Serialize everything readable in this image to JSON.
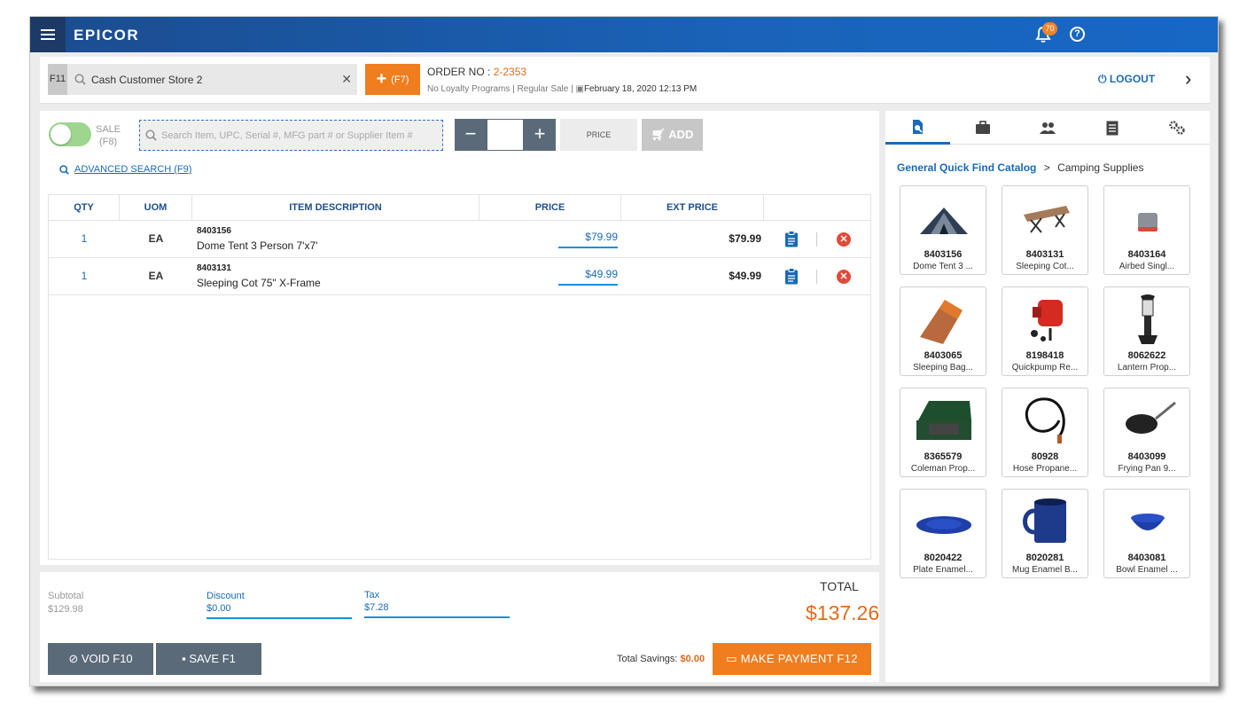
{
  "header": {
    "logo": "EPICOR",
    "notification_count": "70",
    "help_glyph": "?"
  },
  "customer_bar": {
    "f11_key": "F11",
    "customer_value": "Cash Customer Store 2",
    "add_customer_label": "(F7)",
    "order_no_label": "ORDER NO :",
    "order_no_value": "2-2353",
    "loyalty": "No Loyalty Programs",
    "sale_type": "Regular Sale",
    "date": "February 18, 2020 12:13 PM",
    "logout_label": "LOGOUT"
  },
  "toolbar": {
    "sale_label": "SALE",
    "sale_key": "(F8)",
    "search_placeholder": "Search Item, UPC, Serial #, MFG part # or Supplier Item #",
    "qty_value": "",
    "price_label": "PRICE",
    "add_label": "ADD",
    "advanced_search_label": "ADVANCED SEARCH (F9)"
  },
  "table": {
    "headers": {
      "qty": "QTY",
      "uom": "UOM",
      "desc": "ITEM DESCRIPTION",
      "price": "PRICE",
      "ext_price": "EXT PRICE"
    },
    "rows": [
      {
        "qty": "1",
        "uom": "EA",
        "code": "8403156",
        "desc": "Dome Tent 3 Person 7'x7'",
        "price": "$79.99",
        "ext_price": "$79.99"
      },
      {
        "qty": "1",
        "uom": "EA",
        "code": "8403131",
        "desc": "Sleeping Cot 75\" X-Frame",
        "price": "$49.99",
        "ext_price": "$49.99"
      }
    ]
  },
  "totals": {
    "subtotal_label": "Subtotal",
    "subtotal_value": "$129.98",
    "discount_label": "Discount",
    "discount_value": "$0.00",
    "tax_label": "Tax",
    "tax_value": "$7.28",
    "total_label": "TOTAL",
    "total_value": "$137.26",
    "savings_label": "Total Savings:",
    "savings_value": "$0.00",
    "void_label": "VOID F10",
    "save_label": "SAVE F1",
    "payment_label": "MAKE PAYMENT F12"
  },
  "catalog": {
    "tabs": [
      "quick-find-icon",
      "briefcase-icon",
      "customers-icon",
      "list-icon",
      "settings-icon"
    ],
    "breadcrumb_link": "General Quick Find Catalog",
    "breadcrumb_sep": ">",
    "breadcrumb_current": "Camping Supplies",
    "items": [
      {
        "code": "8403156",
        "name": "Dome Tent 3 ...",
        "icon": "tent-icon"
      },
      {
        "code": "8403131",
        "name": "Sleeping Cot...",
        "icon": "cot-icon"
      },
      {
        "code": "8403164",
        "name": "Airbed Singl...",
        "icon": "airbed-icon"
      },
      {
        "code": "8403065",
        "name": "Sleeping Bag...",
        "icon": "sleeping-bag-icon"
      },
      {
        "code": "8198418",
        "name": "Quickpump Re...",
        "icon": "pump-icon"
      },
      {
        "code": "8062622",
        "name": "Lantern Prop...",
        "icon": "lantern-icon"
      },
      {
        "code": "8365579",
        "name": "Coleman Prop...",
        "icon": "stove-icon"
      },
      {
        "code": "80928",
        "name": "Hose Propane...",
        "icon": "hose-icon"
      },
      {
        "code": "8403099",
        "name": "Frying Pan 9...",
        "icon": "pan-icon"
      },
      {
        "code": "8020422",
        "name": "Plate Enamel...",
        "icon": "plate-icon"
      },
      {
        "code": "8020281",
        "name": "Mug Enamel B...",
        "icon": "mug-icon"
      },
      {
        "code": "8403081",
        "name": "Bowl Enamel ...",
        "icon": "bowl-icon"
      }
    ]
  },
  "colors": {
    "header_blue": "#1a63b8",
    "accent_orange": "#f07d1e",
    "link_blue": "#1a6ab8",
    "button_slate": "#5b6a78"
  }
}
